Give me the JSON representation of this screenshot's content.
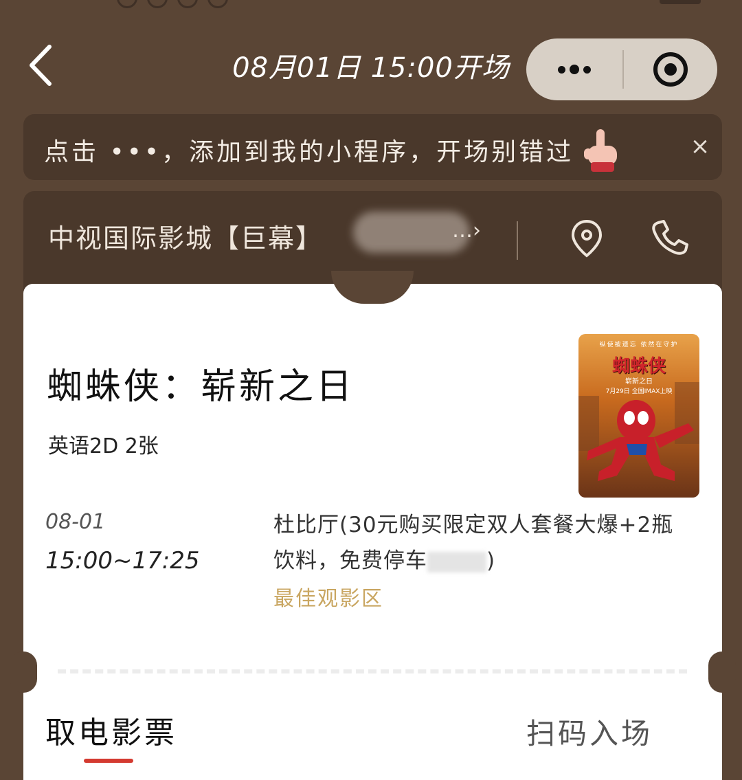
{
  "header": {
    "title": "08月01日 15:00开场",
    "back_icon": "chevron-left-icon",
    "more_icon": "more-dots-icon",
    "close_icon": "target-circle-icon"
  },
  "notice": {
    "text": "点击 •••，添加到我的小程序，开场别错过",
    "close": "×"
  },
  "cinema": {
    "name": "中视国际影城【巨幕】",
    "more": "…›",
    "location_icon": "location-pin-icon",
    "phone_icon": "phone-icon"
  },
  "movie": {
    "title": "蜘蛛侠：崭新之日",
    "meta": "英语2D 2张",
    "date": "08-01",
    "time": "15:00~17:25",
    "hall_line1": "杜比厅(30元购买限定双人套餐大爆+2瓶",
    "hall_line2": "饮料，免费停车",
    "hall_end": ")",
    "best_zone": "最佳观影区",
    "poster": {
      "tagline": "纵使被遗忘 依然在守护",
      "title": "蜘蛛侠",
      "subtitle": "崭新之日",
      "date": "7月29日 全国IMAX上映"
    }
  },
  "tabs": {
    "left": "取电影票",
    "right": "扫码入场"
  },
  "colors": {
    "background": "#5a4535",
    "accent_red": "#d43a30",
    "gold": "#c9a661"
  }
}
